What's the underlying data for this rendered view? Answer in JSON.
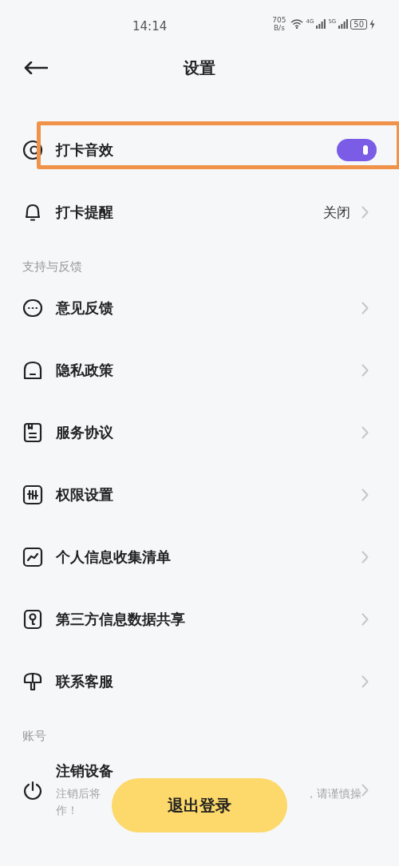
{
  "status_bar": {
    "time": "14:14",
    "net_speed": "705",
    "net_unit": "B/s",
    "signal_1": "4G",
    "signal_2": "5G",
    "battery": "50"
  },
  "header": {
    "title": "设置"
  },
  "groups": [
    {
      "items": [
        {
          "kind": "toggle",
          "label": "打卡音效",
          "on": true
        },
        {
          "kind": "value",
          "label": "打卡提醒",
          "value": "关闭"
        }
      ]
    },
    {
      "title": "支持与反馈",
      "items": [
        {
          "kind": "link",
          "label": "意见反馈"
        },
        {
          "kind": "link",
          "label": "隐私政策"
        },
        {
          "kind": "link",
          "label": "服务协议"
        },
        {
          "kind": "link",
          "label": "权限设置"
        },
        {
          "kind": "link",
          "label": "个人信息收集清单"
        },
        {
          "kind": "link",
          "label": "第三方信息数据共享"
        },
        {
          "kind": "link",
          "label": "联系客服"
        }
      ]
    },
    {
      "title": "账号",
      "items": [
        {
          "kind": "described",
          "label": "注销设备",
          "description_parts": [
            "注销后将",
            "，请谨慎操",
            "作！"
          ]
        }
      ]
    }
  ],
  "logout_button": "退出登录"
}
